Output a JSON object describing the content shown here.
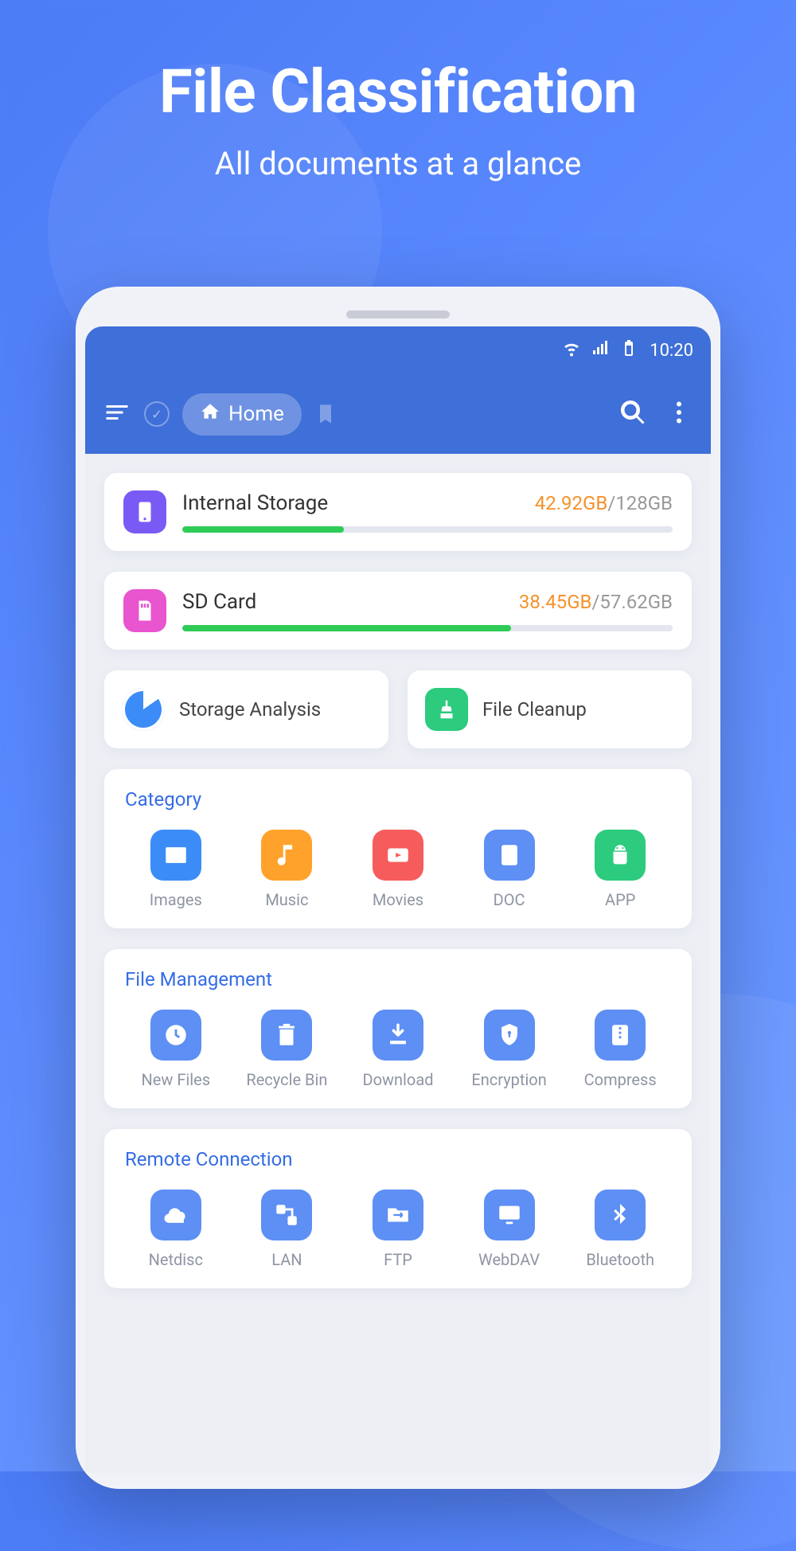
{
  "hero": {
    "title": "File Classification",
    "subtitle": "All documents at a glance"
  },
  "statusbar": {
    "time": "10:20"
  },
  "appbar": {
    "home_label": "Home"
  },
  "storage": [
    {
      "name": "Internal Storage",
      "used": "42.92GB",
      "total": "128GB",
      "used_bytes": 42.92,
      "total_bytes": 128,
      "color": "#7A5AF5"
    },
    {
      "name": "SD Card",
      "used": "38.45GB",
      "total": "57.62GB",
      "used_bytes": 38.45,
      "total_bytes": 57.62,
      "color": "#E954CF"
    }
  ],
  "tools": [
    {
      "label": "Storage Analysis"
    },
    {
      "label": "File Cleanup"
    }
  ],
  "sections": {
    "category": {
      "title": "Category",
      "items": [
        {
          "label": "Images",
          "icon": "image-icon",
          "bg": "bg-bluefill"
        },
        {
          "label": "Music",
          "icon": "music-icon",
          "bg": "bg-orange"
        },
        {
          "label": "Movies",
          "icon": "video-icon",
          "bg": "bg-red"
        },
        {
          "label": "DOC",
          "icon": "doc-icon",
          "bg": "bg-bluetile"
        },
        {
          "label": "APP",
          "icon": "android-icon",
          "bg": "bg-green"
        }
      ]
    },
    "management": {
      "title": "File Management",
      "items": [
        {
          "label": "New Files",
          "icon": "clock-icon"
        },
        {
          "label": "Recycle Bin",
          "icon": "trash-icon"
        },
        {
          "label": "Download",
          "icon": "download-icon"
        },
        {
          "label": "Encryption",
          "icon": "shield-icon"
        },
        {
          "label": "Compress",
          "icon": "archive-icon"
        }
      ]
    },
    "remote": {
      "title": "Remote Connection",
      "items": [
        {
          "label": "Netdisc",
          "icon": "cloud-icon"
        },
        {
          "label": "LAN",
          "icon": "lan-icon"
        },
        {
          "label": "FTP",
          "icon": "folder-swap-icon"
        },
        {
          "label": "WebDAV",
          "icon": "monitor-icon"
        },
        {
          "label": "Bluetooth",
          "icon": "bluetooth-icon"
        }
      ]
    }
  }
}
